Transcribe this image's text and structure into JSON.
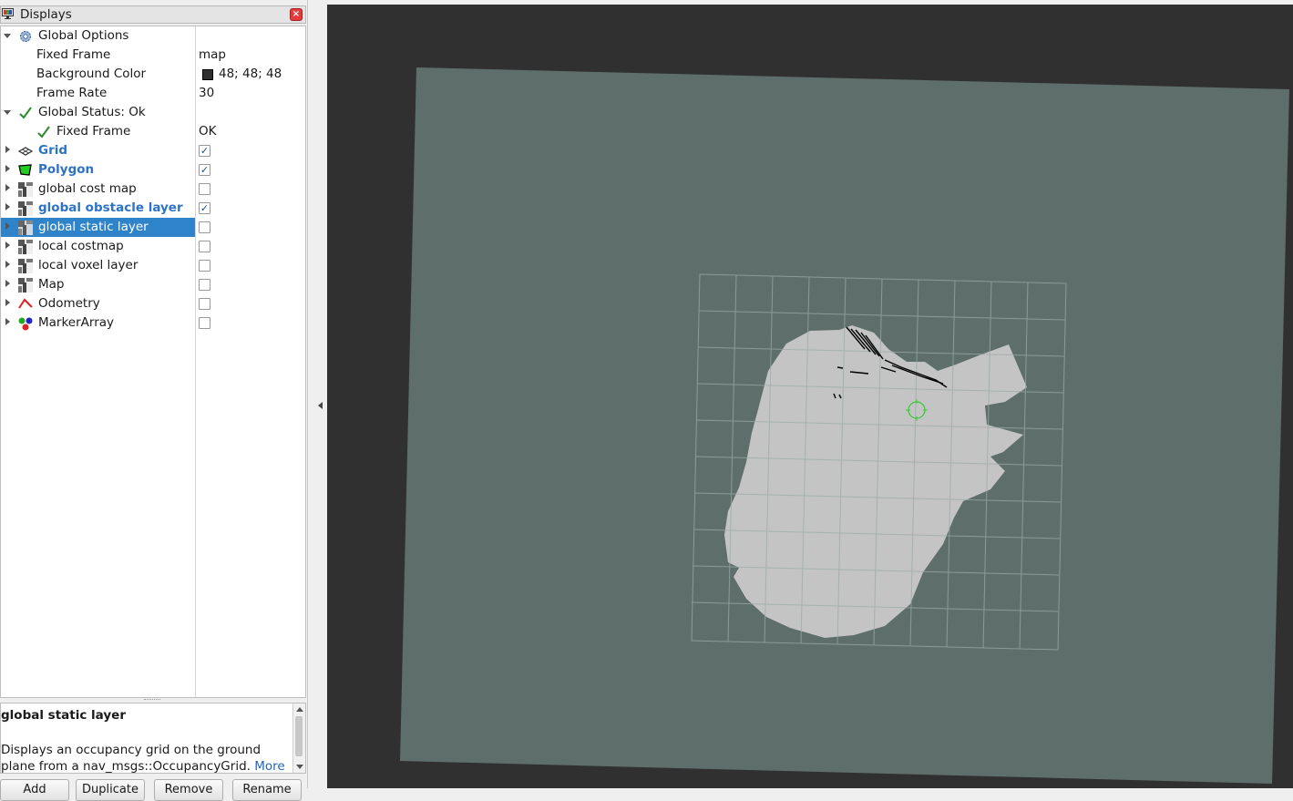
{
  "panel": {
    "title": "Displays"
  },
  "tree": {
    "global_options": {
      "label": "Global Options",
      "fixed_frame": {
        "label": "Fixed Frame",
        "value": "map"
      },
      "background_color": {
        "label": "Background Color",
        "value": "48; 48; 48",
        "color": "#303030"
      },
      "frame_rate": {
        "label": "Frame Rate",
        "value": "30"
      }
    },
    "global_status": {
      "label": "Global Status: Ok",
      "fixed_frame": {
        "label": "Fixed Frame",
        "value": "OK"
      }
    },
    "displays": [
      {
        "label": "Grid",
        "checked": true,
        "icon": "grid-icon"
      },
      {
        "label": "Polygon",
        "checked": true,
        "icon": "polygon-icon"
      },
      {
        "label": "global cost map",
        "checked": false,
        "icon": "map-icon"
      },
      {
        "label": "global obstacle layer",
        "checked": true,
        "icon": "map-icon"
      },
      {
        "label": "global static layer",
        "checked": false,
        "icon": "map-icon",
        "selected": true
      },
      {
        "label": "local costmap",
        "checked": false,
        "icon": "map-icon"
      },
      {
        "label": "local voxel layer",
        "checked": false,
        "icon": "map-icon"
      },
      {
        "label": "Map",
        "checked": false,
        "icon": "map-icon"
      },
      {
        "label": "Odometry",
        "checked": false,
        "icon": "odometry-icon"
      },
      {
        "label": "MarkerArray",
        "checked": false,
        "icon": "marker-array-icon"
      }
    ],
    "check_glyph": "✓"
  },
  "description": {
    "title": "global static layer",
    "text": "Displays an occupancy grid on the ground plane from a nav_msgs::OccupancyGrid.",
    "more_link": "More"
  },
  "buttons": {
    "add": "Add",
    "duplicate": "Duplicate",
    "remove": "Remove",
    "rename": "Rename"
  },
  "colors": {
    "background": "#303030",
    "map_plane": "#5e6e6b",
    "free_space": "#c4c4c4",
    "grid_lines": "#9aaba8",
    "obstacles": "#000000",
    "robot_marker": "#33cc33",
    "selection": "#2f83c8",
    "enabled_text": "#2d72c4"
  }
}
